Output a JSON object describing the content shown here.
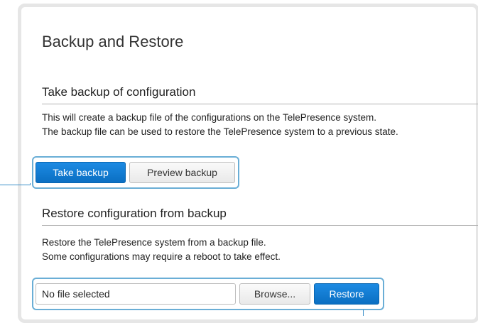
{
  "page": {
    "title": "Backup and Restore"
  },
  "backup_section": {
    "heading": "Take backup of configuration",
    "description_line1": "This will create a backup file of the configurations on the TelePresence system.",
    "description_line2": "The backup file can be used to restore the TelePresence system to a previous state.",
    "take_backup_label": "Take backup",
    "preview_backup_label": "Preview backup"
  },
  "restore_section": {
    "heading": "Restore configuration from backup",
    "description_line1": "Restore the TelePresence system from a backup file.",
    "description_line2": "Some configurations may require a reboot to take effect.",
    "file_field_value": "No file selected",
    "browse_label": "Browse...",
    "restore_label": "Restore"
  },
  "colors": {
    "primary_button": "#0a6fc2",
    "highlight_outline": "#6aaed6",
    "callout_line": "#3a8fc9"
  }
}
